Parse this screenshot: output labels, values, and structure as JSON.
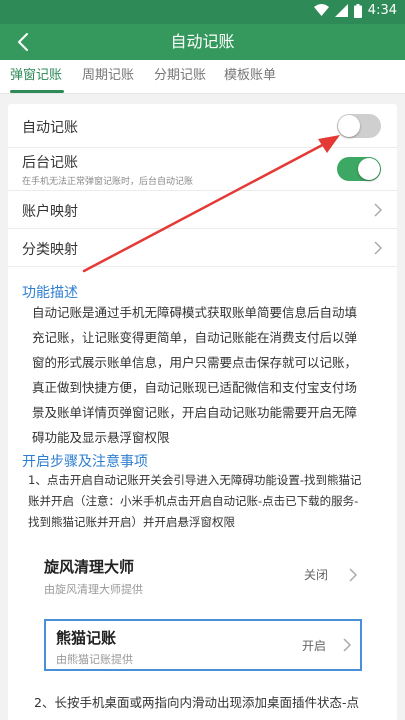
{
  "status_bar": {
    "time": "4:34"
  },
  "app_bar": {
    "title": "自动记账"
  },
  "tabs": [
    {
      "label": "弹窗记账",
      "active": true
    },
    {
      "label": "周期记账",
      "active": false
    },
    {
      "label": "分期记账",
      "active": false
    },
    {
      "label": "模板账单",
      "active": false
    }
  ],
  "settings": {
    "auto": {
      "label": "自动记账",
      "enabled": false
    },
    "background": {
      "label": "后台记账",
      "sublabel": "在手机无法正常弹窗记账时，后台自动记账",
      "enabled": true
    },
    "account_mapping": {
      "label": "账户映射"
    },
    "category_mapping": {
      "label": "分类映射"
    }
  },
  "description": {
    "title": "功能描述",
    "lines": [
      "自动记账是通过手机无障碍模式获取账单简要信息后自动填",
      "充记账，让记账变得更简单，自动记账能在消费支付后以弹",
      "窗的形式展示账单信息，用户只需要点击保存就可以记账，",
      "真正做到快捷方便，自动记账现已适配微信和支付宝支付场",
      "景及账单详情页弹窗记账，开启自动记账功能需要开启无障",
      "碍功能及显示悬浮窗权限"
    ]
  },
  "steps": {
    "title": "开启步骤及注意事项",
    "step1_lines": [
      "1、点击开启自动记账开关会引导进入无障碍功能设置-找到熊猫记",
      "账并开启（注意：小米手机点击开启自动记账-点击已下载的服务-",
      "找到熊猫记账并开启）并开启悬浮窗权限"
    ],
    "step2": "2、长按手机桌面或两指向内滑动出现添加桌面插件状态-点"
  },
  "services": [
    {
      "name": "旋风清理大师",
      "provider": "由旋风清理大师提供",
      "status": "关闭"
    },
    {
      "name": "熊猫记账",
      "provider": "由熊猫记账提供",
      "status": "开启"
    }
  ],
  "colors": {
    "status_bar": "#2e8b57",
    "app_bar": "#35995d",
    "accent": "#2e8b57",
    "link_blue": "#2f7fd1",
    "arrow_red": "#e53935",
    "highlight_border": "#4a90d9"
  }
}
